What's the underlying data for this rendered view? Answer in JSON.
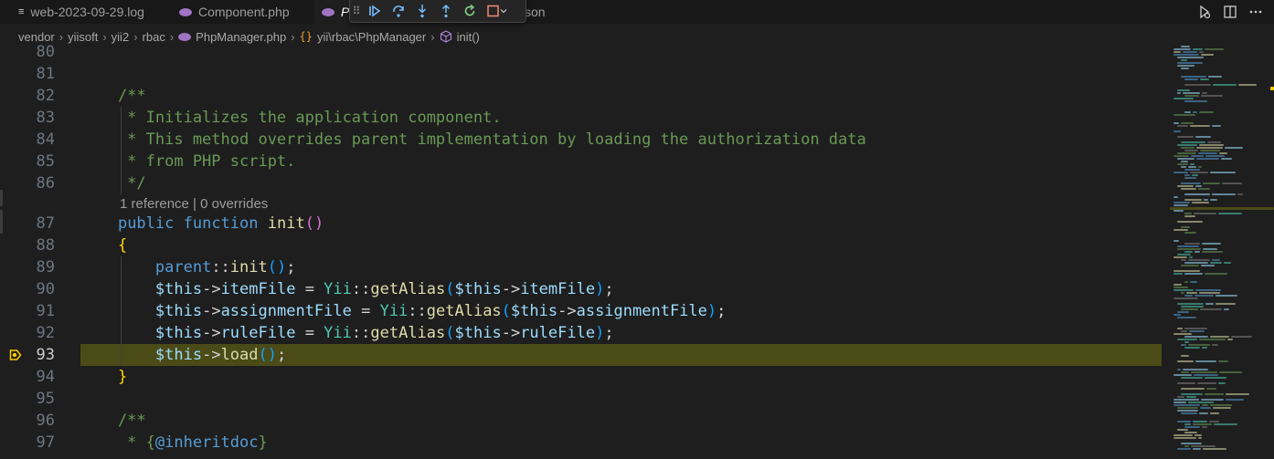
{
  "tabs": [
    {
      "label": "web-2023-09-29.log",
      "icon": "lines-icon"
    },
    {
      "label": "Component.php",
      "icon": "php-icon"
    },
    {
      "label": "P",
      "icon": "php-icon",
      "active": true
    },
    {
      "label": "son",
      "icon": "none"
    }
  ],
  "breadcrumb": [
    {
      "label": "vendor"
    },
    {
      "label": "yiisoft"
    },
    {
      "label": "yii2"
    },
    {
      "label": "rbac"
    },
    {
      "label": "PhpManager.php",
      "icon": "php-icon"
    },
    {
      "label": "yii\\rbac\\PhpManager",
      "icon": "braces-icon"
    },
    {
      "label": "init()",
      "icon": "cube-icon"
    }
  ],
  "codelens": "1 reference | 0 overrides",
  "current_line": 93,
  "lines": [
    {
      "num": "80",
      "tokens": []
    },
    {
      "num": "81",
      "tokens": []
    },
    {
      "num": "82",
      "tokens": [
        {
          "t": "    /**",
          "c": "com"
        }
      ]
    },
    {
      "num": "83",
      "tokens": [
        {
          "t": "     * Initializes the application component.",
          "c": "com"
        }
      ]
    },
    {
      "num": "84",
      "tokens": [
        {
          "t": "     * This method overrides parent implementation by loading the authorization data",
          "c": "com"
        }
      ]
    },
    {
      "num": "85",
      "tokens": [
        {
          "t": "     * from PHP script.",
          "c": "com"
        }
      ]
    },
    {
      "num": "86",
      "tokens": [
        {
          "t": "     */",
          "c": "com"
        }
      ]
    },
    {
      "num": "87",
      "tokens": [
        {
          "t": "    ",
          "c": "txt"
        },
        {
          "t": "public",
          "c": "kw"
        },
        {
          "t": " ",
          "c": "txt"
        },
        {
          "t": "function",
          "c": "kw"
        },
        {
          "t": " ",
          "c": "txt"
        },
        {
          "t": "init",
          "c": "fn"
        },
        {
          "t": "()",
          "c": "p2"
        }
      ]
    },
    {
      "num": "88",
      "tokens": [
        {
          "t": "    ",
          "c": "txt"
        },
        {
          "t": "{",
          "c": "p1"
        }
      ]
    },
    {
      "num": "89",
      "tokens": [
        {
          "t": "        ",
          "c": "txt"
        },
        {
          "t": "parent",
          "c": "kw"
        },
        {
          "t": "::",
          "c": "txt"
        },
        {
          "t": "init",
          "c": "fn"
        },
        {
          "t": "()",
          "c": "p3"
        },
        {
          "t": ";",
          "c": "txt"
        }
      ]
    },
    {
      "num": "90",
      "tokens": [
        {
          "t": "        ",
          "c": "txt"
        },
        {
          "t": "$this",
          "c": "var"
        },
        {
          "t": "->",
          "c": "txt"
        },
        {
          "t": "itemFile",
          "c": "var"
        },
        {
          "t": " = ",
          "c": "txt"
        },
        {
          "t": "Yii",
          "c": "cls"
        },
        {
          "t": "::",
          "c": "txt"
        },
        {
          "t": "getAlias",
          "c": "fn"
        },
        {
          "t": "(",
          "c": "p3"
        },
        {
          "t": "$this",
          "c": "var"
        },
        {
          "t": "->",
          "c": "txt"
        },
        {
          "t": "itemFile",
          "c": "var"
        },
        {
          "t": ")",
          "c": "p3"
        },
        {
          "t": ";",
          "c": "txt"
        }
      ]
    },
    {
      "num": "91",
      "tokens": [
        {
          "t": "        ",
          "c": "txt"
        },
        {
          "t": "$this",
          "c": "var"
        },
        {
          "t": "->",
          "c": "txt"
        },
        {
          "t": "assignmentFile",
          "c": "var"
        },
        {
          "t": " = ",
          "c": "txt"
        },
        {
          "t": "Yii",
          "c": "cls"
        },
        {
          "t": "::",
          "c": "txt"
        },
        {
          "t": "getAlias",
          "c": "fn"
        },
        {
          "t": "(",
          "c": "p3"
        },
        {
          "t": "$this",
          "c": "var"
        },
        {
          "t": "->",
          "c": "txt"
        },
        {
          "t": "assignmentFile",
          "c": "var"
        },
        {
          "t": ")",
          "c": "p3"
        },
        {
          "t": ";",
          "c": "txt"
        }
      ]
    },
    {
      "num": "92",
      "tokens": [
        {
          "t": "        ",
          "c": "txt"
        },
        {
          "t": "$this",
          "c": "var"
        },
        {
          "t": "->",
          "c": "txt"
        },
        {
          "t": "ruleFile",
          "c": "var"
        },
        {
          "t": " = ",
          "c": "txt"
        },
        {
          "t": "Yii",
          "c": "cls"
        },
        {
          "t": "::",
          "c": "txt"
        },
        {
          "t": "getAlias",
          "c": "fn"
        },
        {
          "t": "(",
          "c": "p3"
        },
        {
          "t": "$this",
          "c": "var"
        },
        {
          "t": "->",
          "c": "txt"
        },
        {
          "t": "ruleFile",
          "c": "var"
        },
        {
          "t": ")",
          "c": "p3"
        },
        {
          "t": ";",
          "c": "txt"
        }
      ]
    },
    {
      "num": "93",
      "tokens": [
        {
          "t": "        ",
          "c": "txt"
        },
        {
          "t": "$this",
          "c": "var"
        },
        {
          "t": "->",
          "c": "txt"
        },
        {
          "t": "load",
          "c": "fn"
        },
        {
          "t": "()",
          "c": "p3"
        },
        {
          "t": ";",
          "c": "txt"
        }
      ]
    },
    {
      "num": "94",
      "tokens": [
        {
          "t": "    ",
          "c": "txt"
        },
        {
          "t": "}",
          "c": "p1"
        }
      ]
    },
    {
      "num": "95",
      "tokens": []
    },
    {
      "num": "96",
      "tokens": [
        {
          "t": "    /**",
          "c": "com"
        }
      ]
    },
    {
      "num": "97",
      "tokens": [
        {
          "t": "     * ",
          "c": "com"
        },
        {
          "t": "{",
          "c": "com"
        },
        {
          "t": "@inheritdoc",
          "c": "kw"
        },
        {
          "t": "}",
          "c": "com"
        }
      ]
    }
  ],
  "colors": {
    "editor_bg": "#1e1e1e",
    "current_line_bg": "#4b4b18",
    "breakpoint": "#ffcc00",
    "comment": "#6a9955",
    "keyword": "#569cd6",
    "function": "#dcdcaa",
    "variable": "#9cdcfe",
    "class": "#4ec9b0"
  },
  "debug_toolbar": [
    "drag-handle",
    "continue",
    "step-over",
    "step-into",
    "step-out",
    "restart",
    "stop"
  ]
}
